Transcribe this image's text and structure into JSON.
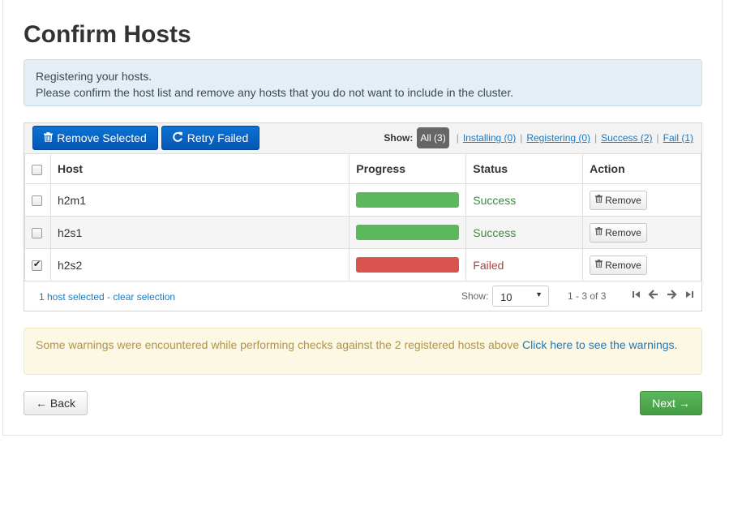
{
  "page": {
    "title": "Confirm Hosts"
  },
  "info_alert": {
    "line1": "Registering your hosts.",
    "line2": "Please confirm the host list and remove any hosts that you do not want to include in the cluster."
  },
  "toolbar": {
    "remove_selected_label": "Remove Selected",
    "retry_failed_label": "Retry Failed",
    "show_label": "Show:",
    "filters": {
      "all": "All (3)",
      "installing": "Installing (0)",
      "registering": "Registering (0)",
      "success": "Success (2)",
      "fail": "Fail (1)"
    }
  },
  "table": {
    "headers": {
      "host": "Host",
      "progress": "Progress",
      "status": "Status",
      "action": "Action"
    },
    "rows": [
      {
        "checked": false,
        "host": "h2m1",
        "progress": 1.0,
        "status": "Success",
        "status_type": "success",
        "action": "Remove"
      },
      {
        "checked": false,
        "host": "h2s1",
        "progress": 1.0,
        "status": "Success",
        "status_type": "success",
        "action": "Remove"
      },
      {
        "checked": true,
        "host": "h2s2",
        "progress": 1.0,
        "status": "Failed",
        "status_type": "failed",
        "action": "Remove"
      }
    ]
  },
  "footer": {
    "selection": "1 host selected",
    "separator": " - ",
    "clear_selection": "clear selection",
    "show_label": "Show:",
    "page_size": "10",
    "range": "1 - 3 of 3"
  },
  "warning": {
    "text": "Some warnings were encountered while performing checks against the 2 registered hosts above ",
    "link": "Click here to see the warnings."
  },
  "nav": {
    "back_label": "← Back",
    "next_label": "Next →"
  },
  "colors": {
    "primary": "#0a6ed1",
    "success": "#5cb85c",
    "danger": "#d9534f",
    "link": "#1a7abf"
  },
  "icons": {
    "remove_selected": "trash-icon",
    "retry_failed": "refresh-icon",
    "remove": "trash-icon",
    "first": "first-page-icon",
    "prev": "prev-page-icon",
    "next": "next-page-icon",
    "last": "last-page-icon"
  }
}
